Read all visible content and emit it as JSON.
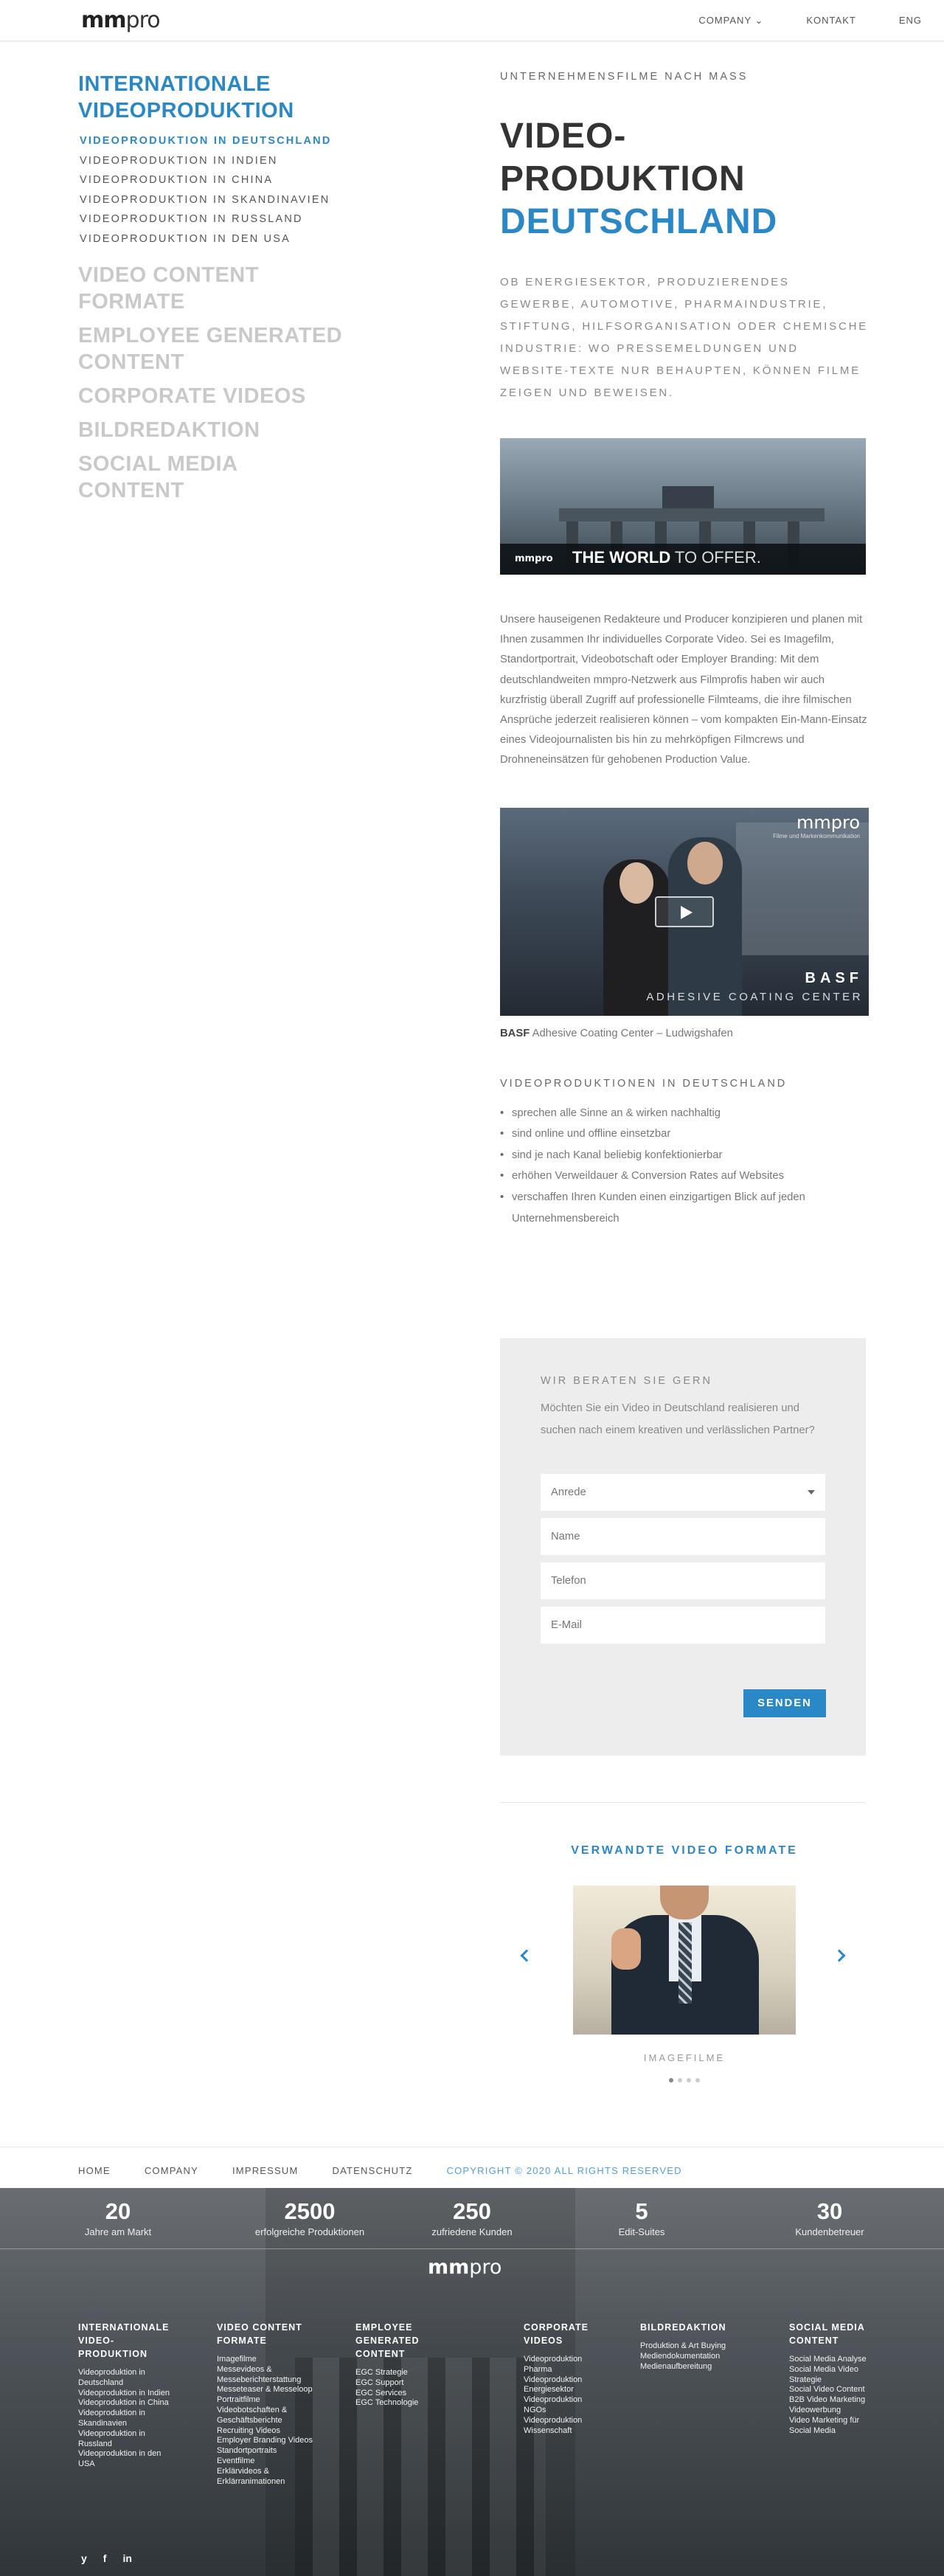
{
  "header": {
    "logo_bold": "mm",
    "logo_light": "pro",
    "nav": [
      "COMPANY ⌄",
      "KONTAKT",
      "ENG"
    ]
  },
  "sidebar": {
    "groups": [
      {
        "label": "INTERNATIONALE VIDEOPRODUKTION",
        "active": true,
        "sub": [
          "VIDEOPRODUKTION IN DEUTSCHLAND",
          "VIDEOPRODUKTION IN INDIEN",
          "VIDEOPRODUKTION IN CHINA",
          "VIDEOPRODUKTION IN SKANDINAVIEN",
          "VIDEOPRODUKTION IN RUSSLAND",
          "VIDEOPRODUKTION IN DEN USA"
        ]
      },
      {
        "label": "VIDEO CONTENT FORMATE"
      },
      {
        "label": "EMPLOYEE GENERATED CONTENT"
      },
      {
        "label": "CORPORATE VIDEOS"
      },
      {
        "label": "BILDREDAKTION"
      },
      {
        "label": "SOCIAL MEDIA CONTENT"
      }
    ]
  },
  "main": {
    "eyebrow": "UNTERNEHMENSFILME NACH MASS",
    "title_line1": "VIDEO-",
    "title_line2": "PRODUKTION",
    "title_line3": "DEUTSCHLAND",
    "intro": "OB ENERGIESEKTOR, PRODUZIERENDES GEWERBE, AUTOMOTIVE, PHARMAINDUSTRIE, STIFTUNG, HILFSORGANISATION ODER CHEMISCHE INDUSTRIE: WO PRESSEMELDUNGEN UND WEBSITE-TEXTE NUR BEHAUPTEN, KÖNNEN FILME ZEIGEN UND BEWEISEN.",
    "banner": {
      "logo": "mmpro",
      "text_bold": "THE WORLD",
      "text_light": "TO OFFER."
    },
    "body": "Unsere hauseigenen Redakteure und Producer konzipieren und planen mit Ihnen zusammen Ihr individuelles Corporate Video. Sei es Imagefilm, Standortportrait, Videobotschaft oder Employer Branding: Mit dem deutschlandweiten mmpro-Netzwerk aus Filmprofis haben wir auch kurzfristig überall Zugriff auf professionelle Filmteams, die ihre filmischen Ansprüche jederzeit realisieren können – vom kompakten Ein-Mann-Einsatz eines Videojournalisten bis hin zu mehrköpfigen Filmcrews und Drohneneinsätzen für gehobenen Production Value.",
    "video": {
      "logo": "mmpro",
      "logo_sub": "Filme und Markenkommunikation",
      "title": "BASF",
      "subtitle": "ADHESIVE COATING CENTER"
    },
    "caption_bold": "BASF",
    "caption_rest": " Adhesive Coating Center – Ludwigshafen",
    "section_title": "VIDEOPRODUKTIONEN IN DEUTSCHLAND",
    "bullets": [
      "sprechen alle Sinne an & wirken nachhaltig",
      "sind online und offline einsetzbar",
      "sind je nach Kanal beliebig konfektionierbar",
      "erhöhen Verweildauer & Conversion Rates auf Websites",
      "verschaffen Ihren Kunden einen einzigartigen Blick auf jeden Unternehmensbereich"
    ]
  },
  "form": {
    "title": "WIR BERATEN SIE GERN",
    "text": "Möchten Sie ein Video in Deutschland realisieren und suchen nach einem kreativen und verlässlichen Partner?",
    "select_value": "Anrede",
    "name_placeholder": "Name",
    "phone_placeholder": "Telefon",
    "email_placeholder": "E-Mail",
    "submit": "SENDEN"
  },
  "related": {
    "title": "VERWANDTE VIDEO FORMATE",
    "caption": "IMAGEFILME",
    "dots": 4,
    "active_dot": 0
  },
  "footer_nav": [
    "HOME",
    "COMPANY",
    "IMPRESSUM",
    "DATENSCHUTZ",
    "COPYRIGHT © 2020  ALL RIGHTS RESERVED"
  ],
  "stats": [
    {
      "n": "20",
      "l": "Jahre am Markt"
    },
    {
      "n": "2500",
      "l": "erfolgreiche Produktionen"
    },
    {
      "n": "250",
      "l": "zufriedene Kunden"
    },
    {
      "n": "5",
      "l": "Edit-Suites"
    },
    {
      "n": "30",
      "l": "Kundenbetreuer"
    }
  ],
  "footer_logo_bold": "mm",
  "footer_logo_light": "pro",
  "footer_cols": [
    {
      "h": [
        "INTERNATIONALE",
        "VIDEO-",
        "PRODUKTION"
      ],
      "items": [
        "Videoproduktion in",
        "Deutschland",
        "Videoproduktion in Indien",
        "Videoproduktion in China",
        "Videoproduktion in",
        "Skandinavien",
        "Videoproduktion in",
        "Russland",
        "Videoproduktion in den",
        "USA"
      ]
    },
    {
      "h": [
        "VIDEO CONTENT",
        "FORMATE"
      ],
      "items": [
        "Imagefilme",
        "Messevideos &",
        "Messeberichterstattung",
        "Messeteaser & Messeloop",
        "Portraitfilme",
        "Videobotschaften &",
        "Geschäftsberichte",
        "Recruiting Videos",
        "Employer Branding Videos",
        "Standortportraits",
        "Eventfilme",
        "Erklärvideos &",
        "Erklärranimationen"
      ]
    },
    {
      "h": [
        "EMPLOYEE",
        "GENERATED",
        "CONTENT"
      ],
      "items": [
        "EGC Strategie",
        "EGC Support",
        "EGC Services",
        "EGC Technologie"
      ]
    },
    {
      "h": [
        "CORPORATE",
        "VIDEOS"
      ],
      "items": [
        "Videoproduktion",
        "Pharma",
        "Videoproduktion",
        "Energiesektor",
        "Videoproduktion",
        "NGOs",
        "Videoproduktion",
        "Wissenschaft"
      ]
    },
    {
      "h": [
        "BILDREDAKTION"
      ],
      "items": [
        "Produktion & Art Buying",
        "Mediendokumentation",
        "Medienaufbereitung"
      ]
    },
    {
      "h": [
        "SOCIAL MEDIA",
        "CONTENT"
      ],
      "items": [
        "Social Media Analyse",
        "Social Media Video",
        "Strategie",
        "Social Video Content",
        "B2B Video Marketing",
        "Videowerbung",
        "Video Marketing für",
        "Social Media"
      ]
    }
  ],
  "social": [
    "y",
    "f",
    "in"
  ]
}
